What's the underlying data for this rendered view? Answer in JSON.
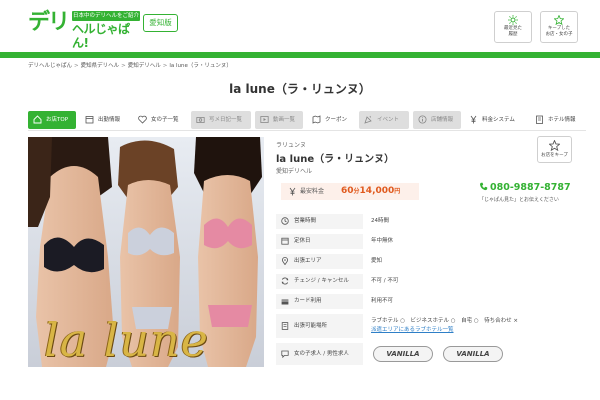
{
  "header": {
    "logo_main": "デリ",
    "logo_tagline": "日本中のデリヘルをご紹介",
    "logo_sub": "ヘルじゃぱん!",
    "area_label": "愛知版",
    "recent_button": [
      "最近見た",
      "履歴"
    ],
    "keep_button": [
      "キープした",
      "お店・女の子"
    ]
  },
  "breadcrumb": [
    "デリヘルじゃぱん",
    "愛知県デリヘル",
    "愛知デリヘル",
    "la lune（ラ・リュンヌ）"
  ],
  "page_title": "la lune（ラ・リュンヌ）",
  "tabs": [
    {
      "label": "お店TOP",
      "state": "active",
      "icon": "home-icon"
    },
    {
      "label": "出勤情報",
      "state": "plain",
      "icon": "calendar-icon"
    },
    {
      "label": "女の子一覧",
      "state": "plain",
      "icon": "heart-icon"
    },
    {
      "label": "写メ日記一覧",
      "state": "disabled",
      "icon": "camera-icon"
    },
    {
      "label": "動画一覧",
      "state": "disabled",
      "icon": "video-icon"
    },
    {
      "label": "クーポン",
      "state": "plain",
      "icon": "map-icon"
    },
    {
      "label": "イベント",
      "state": "disabled",
      "icon": "party-icon"
    },
    {
      "label": "店舗情報",
      "state": "disabled",
      "icon": "info-icon"
    },
    {
      "label": "料金システム",
      "state": "plain",
      "icon": "yen-icon"
    },
    {
      "label": "ホテル情報",
      "state": "plain",
      "icon": "hotel-icon"
    }
  ],
  "hero": {
    "overlay_text": "la lune"
  },
  "shop": {
    "kana": "ラリュンヌ",
    "name": "la lune（ラ・リュンヌ）",
    "area": "愛知デリヘル",
    "keep_label": "お店をキープ"
  },
  "price": {
    "label": "最安料金",
    "minutes": "60",
    "minutes_unit": "分",
    "amount": "14,000",
    "currency": "円"
  },
  "phone": {
    "number": "080-9887-8787",
    "note": "「じゃぱん見た」とお伝えください"
  },
  "info_rows": [
    {
      "label": "営業時間",
      "value": "24時間",
      "icon": "clock-icon"
    },
    {
      "label": "定休日",
      "value": "年中無休",
      "icon": "calendar-icon"
    },
    {
      "label": "出張エリア",
      "value": "愛知",
      "icon": "pin-icon"
    },
    {
      "label": "チェンジ / キャンセル",
      "value": "不可 / 不可",
      "icon": "refresh-icon"
    },
    {
      "label": "カード利用",
      "value": "利用不可",
      "icon": "card-icon"
    },
    {
      "label": "出張可能場所",
      "value": "ラブホテル ○　ビジネスホテル ○　自宅 ○　待ち合わせ ×",
      "link": "派遣エリアにあるラブホテル一覧",
      "icon": "hotel-icon"
    },
    {
      "label": "女の子求人 / 男性求人",
      "value": "",
      "icon": "chat-icon"
    }
  ],
  "vanilla_badges": [
    "VANILLA",
    "VANILLA"
  ],
  "colors": {
    "brand": "#34b233",
    "price": "#e05a1e",
    "link": "#2e7fc7"
  }
}
